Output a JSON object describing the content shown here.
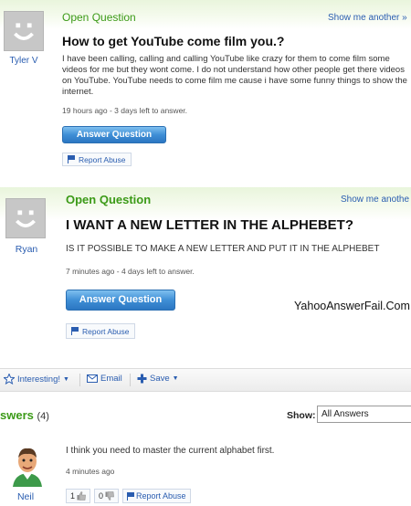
{
  "q1": {
    "badge": "Open Question",
    "show_me": "Show me another »",
    "user": "Tyler V",
    "title": "How to get YouTube come film you.?",
    "body": "I have been calling, calling and calling YouTube like crazy for them to come film some videos for me but they wont come. I do not understand how other people get there videos on YouTube. YouTube needs to come film me cause i have some funny things to show the internet.",
    "meta": "19 hours ago - 3 days left to answer.",
    "answer_button": "Answer Question",
    "report": "Report Abuse"
  },
  "q2": {
    "badge": "Open Question",
    "show_me": "Show me anothe",
    "user": "Ryan",
    "title": "I WANT A NEW LETTER IN THE ALPHEBET?",
    "body": "IS IT POSSIBLE TO MAKE A NEW LETTER AND PUT IT IN THE ALPHEBET",
    "meta": "7 minutes ago - 4 days left to answer.",
    "answer_button": "Answer Question",
    "report": "Report Abuse",
    "watermark": "YahooAnswerFail.Com"
  },
  "actions": {
    "interesting": "Interesting!",
    "email": "Email",
    "save": "Save"
  },
  "answers": {
    "title": "swers",
    "count": "(4)",
    "show_label": "Show:",
    "filter_value": "All Answers",
    "items": [
      {
        "user": "Neil",
        "text": "I think you need to master the current alphabet first.",
        "meta": "4 minutes ago",
        "thumbs_up": "1",
        "thumbs_down": "0",
        "report": "Report Abuse"
      }
    ]
  },
  "colors": {
    "green": "#3b9a17",
    "link": "#2a5db0",
    "button_blue": "#3f8fd6"
  }
}
